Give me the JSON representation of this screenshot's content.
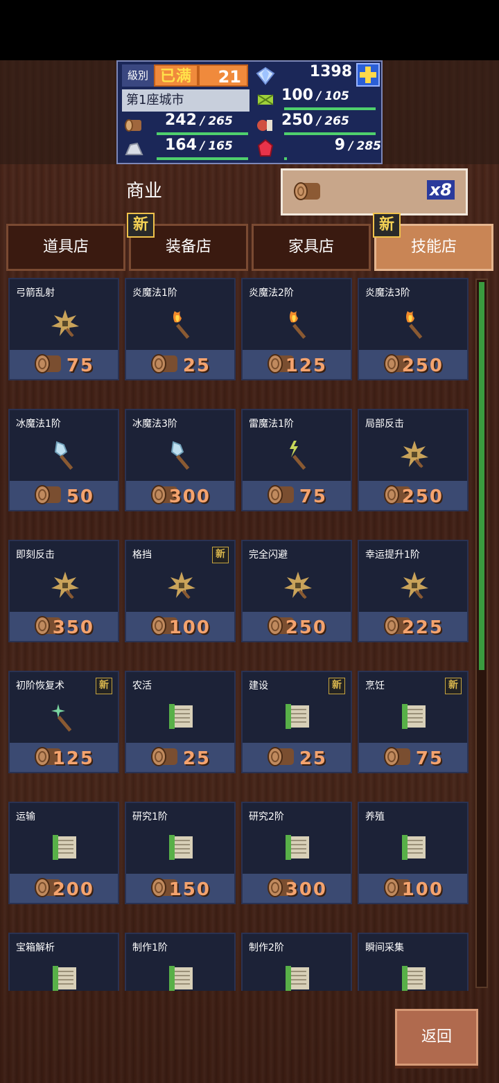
{
  "hud": {
    "level_label": "級別",
    "level_badge": "已满",
    "level_value": "21",
    "diamonds": "1398",
    "city_name": "第1座城市",
    "grass": {
      "current": "100",
      "max": "105",
      "fill": 0.95
    },
    "wood": {
      "current": "242",
      "max": "265",
      "fill": 0.91
    },
    "food": {
      "current": "250",
      "max": "265",
      "fill": 0.94
    },
    "stone": {
      "current": "164",
      "max": "165",
      "fill": 0.99
    },
    "ruby": {
      "current": "9",
      "max": "285",
      "fill": 0.03
    },
    "separator": "/"
  },
  "header": {
    "title": "商业",
    "currency_count": "x8"
  },
  "tabs": [
    {
      "label": "道具店",
      "new": false,
      "active": false
    },
    {
      "label": "装备店",
      "new": true,
      "active": false
    },
    {
      "label": "家具店",
      "new": false,
      "active": false
    },
    {
      "label": "技能店",
      "new": true,
      "active": true
    }
  ],
  "new_badge": "新",
  "items": [
    {
      "name": "弓箭乱射",
      "price": "75",
      "icon": "star-mace-icon",
      "new": false
    },
    {
      "name": "炎魔法1阶",
      "price": "25",
      "icon": "fire-staff-icon",
      "new": false
    },
    {
      "name": "炎魔法2阶",
      "price": "125",
      "icon": "fire-staff-icon",
      "new": false
    },
    {
      "name": "炎魔法3阶",
      "price": "250",
      "icon": "fire-staff-icon",
      "new": false
    },
    {
      "name": "冰魔法1阶",
      "price": "50",
      "icon": "ice-staff-icon",
      "new": false
    },
    {
      "name": "冰魔法3阶",
      "price": "300",
      "icon": "ice-staff-icon",
      "new": false
    },
    {
      "name": "雷魔法1阶",
      "price": "75",
      "icon": "thunder-staff-icon",
      "new": false
    },
    {
      "name": "局部反击",
      "price": "250",
      "icon": "star-mace-icon",
      "new": false
    },
    {
      "name": "即刻反击",
      "price": "350",
      "icon": "star-mace-icon",
      "new": false
    },
    {
      "name": "格挡",
      "price": "100",
      "icon": "star-mace-icon",
      "new": true
    },
    {
      "name": "完全闪避",
      "price": "250",
      "icon": "star-mace-icon",
      "new": false
    },
    {
      "name": "幸运提升1阶",
      "price": "225",
      "icon": "star-mace-icon",
      "new": false
    },
    {
      "name": "初阶恢复术",
      "price": "125",
      "icon": "heal-staff-icon",
      "new": true
    },
    {
      "name": "农活",
      "price": "25",
      "icon": "scroll-icon",
      "new": false
    },
    {
      "name": "建设",
      "price": "25",
      "icon": "scroll-icon",
      "new": true
    },
    {
      "name": "烹饪",
      "price": "75",
      "icon": "scroll-icon",
      "new": true
    },
    {
      "name": "运输",
      "price": "200",
      "icon": "scroll-icon",
      "new": false
    },
    {
      "name": "研究1阶",
      "price": "150",
      "icon": "scroll-icon",
      "new": false
    },
    {
      "name": "研究2阶",
      "price": "300",
      "icon": "scroll-icon",
      "new": false
    },
    {
      "name": "养殖",
      "price": "100",
      "icon": "scroll-icon",
      "new": false
    },
    {
      "name": "宝箱解析",
      "price": "",
      "icon": "scroll-icon",
      "new": false
    },
    {
      "name": "制作1阶",
      "price": "",
      "icon": "scroll-icon",
      "new": false
    },
    {
      "name": "制作2阶",
      "price": "",
      "icon": "scroll-icon",
      "new": false
    },
    {
      "name": "瞬间采集",
      "price": "",
      "icon": "scroll-icon",
      "new": false
    }
  ],
  "scroll_position": 0.0,
  "back_label": "返回",
  "colors": {
    "price": "#f4a36e",
    "card_bg": "#1c2237",
    "bar_green": "#4fd06d"
  }
}
